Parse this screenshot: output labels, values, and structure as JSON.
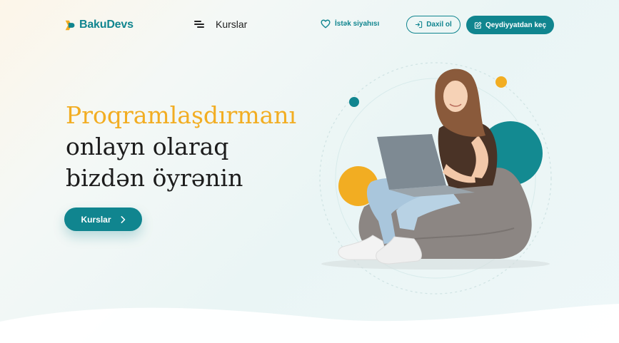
{
  "brand": {
    "name_part1": "Baku",
    "name_part2": "Devs"
  },
  "nav": {
    "courses_label": "Kurslar",
    "wishlist_label": "İstək siyahısı"
  },
  "auth": {
    "login_label": "Daxil ol",
    "register_label": "Qeydiyyatdan keç"
  },
  "hero": {
    "title_line1": "Proqramlaşdırmanı",
    "title_line2": "onlayn olaraq",
    "title_line3": "bizdən öyrənin",
    "cta_label": "Kurslar"
  },
  "colors": {
    "primary": "#10858f",
    "accent": "#f2ad22",
    "text": "#1c1c1c"
  },
  "icons": {
    "logo": "bakudevs-logo-icon",
    "menu": "menu-icon",
    "wishlist": "heart-icon",
    "login": "login-arrow-icon",
    "register": "edit-icon",
    "cta": "chevron-right-icon"
  }
}
